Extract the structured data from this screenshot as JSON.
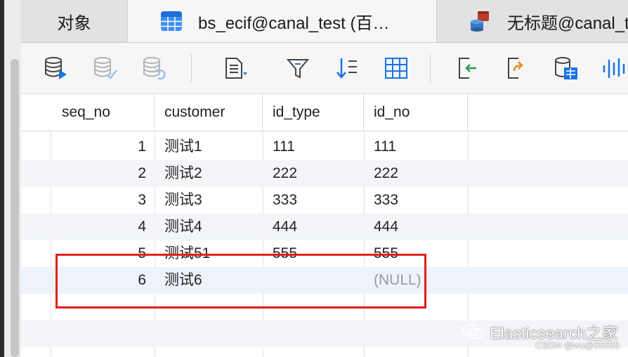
{
  "tabs": [
    {
      "label": "对象"
    },
    {
      "label": "bs_ecif@canal_test (百…"
    },
    {
      "label": "无标题@canal_t"
    }
  ],
  "toolbar": {
    "icons": [
      "begin-transaction-icon",
      "commit-icon",
      "rollback-icon",
      "text-view-icon",
      "filter-icon",
      "sort-icon",
      "grid-view-icon",
      "import-icon",
      "export-icon",
      "data-generator-icon",
      "stats-icon"
    ]
  },
  "table": {
    "columns": [
      "seq_no",
      "customer",
      "id_type",
      "id_no"
    ],
    "rows": [
      {
        "seq_no": "1",
        "customer": "测试1",
        "id_type": "111",
        "id_no": "111"
      },
      {
        "seq_no": "2",
        "customer": "测试2",
        "id_type": "222",
        "id_no": "222"
      },
      {
        "seq_no": "3",
        "customer": "测试3",
        "id_type": "333",
        "id_no": "333"
      },
      {
        "seq_no": "4",
        "customer": "测试4",
        "id_type": "444",
        "id_no": "444"
      },
      {
        "seq_no": "5",
        "customer": "测试51",
        "id_type": "555",
        "id_no": "555"
      },
      {
        "seq_no": "6",
        "customer": "测试6",
        "id_type": "",
        "id_no": "(NULL)"
      }
    ]
  },
  "watermark": {
    "text": "Elasticsearch之家",
    "credit": "CSDN @wu@55555"
  },
  "colors": {
    "highlight": "#e0201a",
    "accent": "#1a73e8"
  }
}
